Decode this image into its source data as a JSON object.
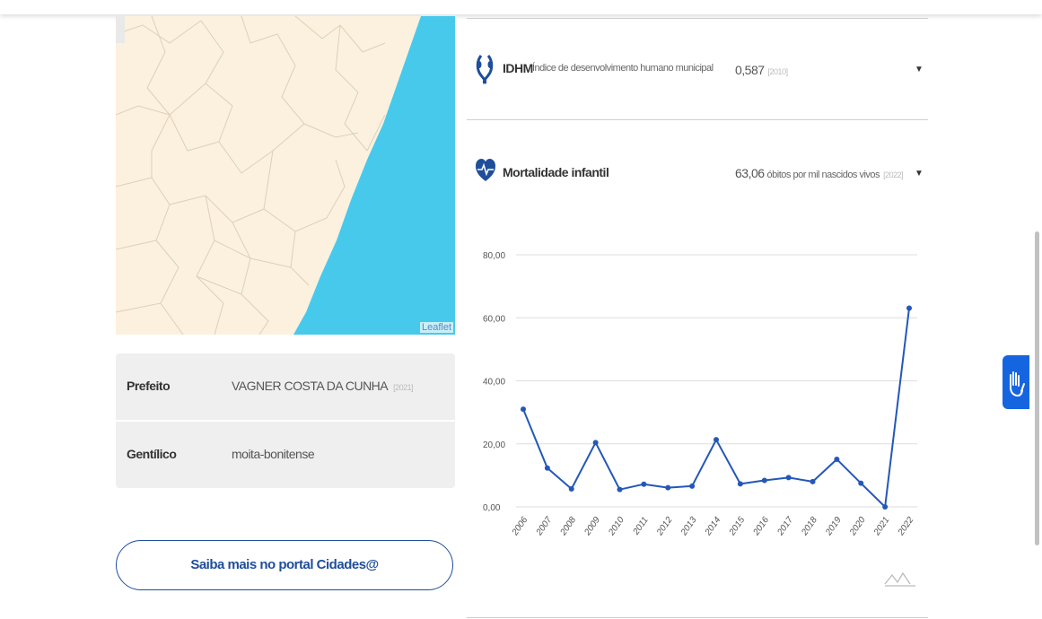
{
  "map": {
    "attribution": "Leaflet"
  },
  "info": {
    "rows": [
      {
        "label": "Prefeito",
        "value": "VAGNER COSTA DA CUNHA",
        "year": "[2021]"
      },
      {
        "label": "Gentílico",
        "value": "moita-bonitense",
        "year": ""
      }
    ]
  },
  "button": {
    "label": "Saiba mais no portal Cidades@"
  },
  "indicators": {
    "idhm": {
      "title": "IDHM",
      "subtitle": "Índice de desenvolvimento humano municipal",
      "value": "0,587",
      "year": "[2010]"
    },
    "mortalidade": {
      "title": "Mortalidade infantil",
      "value": "63,06",
      "unit": "óbitos por mil nascidos vivos",
      "year": "[2022]"
    }
  },
  "colors": {
    "accent": "#1f4e9b",
    "line": "#2457b8",
    "sea": "#47c9ec",
    "land": "#fcf1df"
  },
  "icons": {
    "idhm": "laurel-icon",
    "mortalidade": "heart-pulse-icon",
    "chart_toggle": "line-chart-icon",
    "accessibility": "hand-sign-icon"
  },
  "chart_data": {
    "type": "line",
    "x": [
      "2006",
      "2007",
      "2008",
      "2009",
      "2010",
      "2011",
      "2012",
      "2013",
      "2014",
      "2015",
      "2016",
      "2017",
      "2018",
      "2019",
      "2020",
      "2021",
      "2022"
    ],
    "series": [
      {
        "values": [
          31,
          12.3,
          5.7,
          20.4,
          5.5,
          7.2,
          6.1,
          6.6,
          21.3,
          7.3,
          8.4,
          9.3,
          8.0,
          15.1,
          7.5,
          0,
          63.06
        ]
      }
    ],
    "yticks": [
      "0,00",
      "20,00",
      "40,00",
      "60,00",
      "80,00"
    ],
    "ylim": [
      0,
      80
    ],
    "grid": true
  }
}
